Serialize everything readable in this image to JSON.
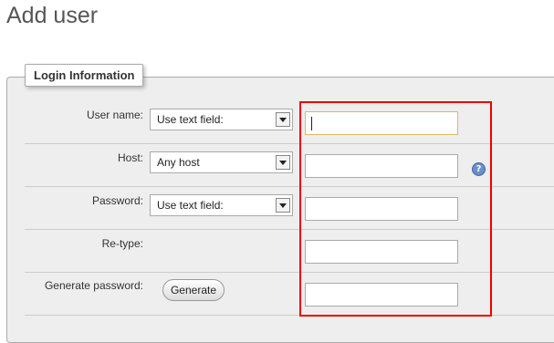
{
  "page": {
    "title": "Add user"
  },
  "fieldset": {
    "legend": "Login Information"
  },
  "rows": {
    "username": {
      "label": "User name:",
      "select_value": "Use text field:",
      "input_value": ""
    },
    "host": {
      "label": "Host:",
      "select_value": "Any host",
      "input_value": "",
      "help_icon": "?"
    },
    "password": {
      "label": "Password:",
      "select_value": "Use text field:",
      "input_value": ""
    },
    "retype": {
      "label": "Re-type:",
      "input_value": ""
    },
    "generate": {
      "label": "Generate password:",
      "button_label": "Generate",
      "input_value": ""
    }
  },
  "colors": {
    "highlight": "#ee0000",
    "focus_border": "#e0b960",
    "help_icon": "#6c8fc9"
  },
  "icons": {
    "help": "question-circle-icon",
    "dropdown": "chevron-down-icon"
  }
}
